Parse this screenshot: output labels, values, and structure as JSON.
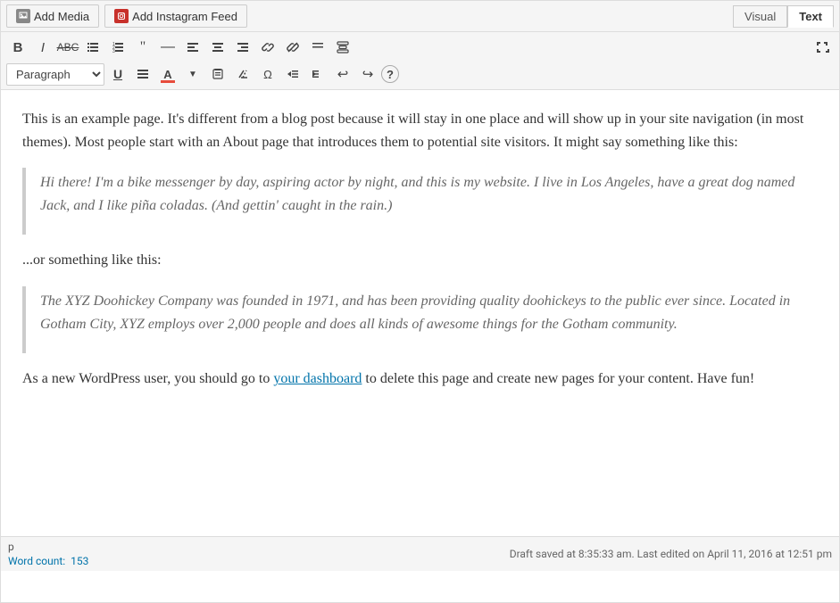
{
  "topbar": {
    "add_media_label": "Add Media",
    "add_instagram_label": "Add Instagram Feed",
    "visual_tab": "Visual",
    "text_tab": "Text"
  },
  "toolbar": {
    "row1": {
      "bold": "B",
      "italic": "I",
      "strikethrough": "ABC",
      "ul": "≡",
      "ol": "≡",
      "blockquote": "\"\"",
      "hr": "—",
      "align_left": "≡",
      "align_center": "≡",
      "align_right": "≡",
      "link": "🔗",
      "unlink": "🔗",
      "insert": "≡",
      "toolbar": "⊞",
      "fullscreen": "⤢"
    },
    "row2": {
      "format_label": "Paragraph",
      "underline": "U",
      "justify": "≡",
      "text_color": "A",
      "paste_text": "📋",
      "clear_format": "◌",
      "special_char": "Ω",
      "indent_dec": "⇤",
      "indent_inc": "⇥",
      "undo": "↩",
      "redo": "↪",
      "help": "?"
    }
  },
  "content": {
    "paragraph1": "This is an example page. It's different from a blog post because it will stay in one place and will show up in your site navigation (in most themes). Most people start with an About page that introduces them to potential site visitors. It might say something like this:",
    "quote1": "Hi there! I'm a bike messenger by day, aspiring actor by night, and this is my website. I live in Los Angeles, have a great dog named Jack, and I like piña coladas. (And gettin' caught in the rain.)",
    "paragraph2": "...or something like this:",
    "quote2": "The XYZ Doohickey Company was founded in 1971, and has been providing quality doohickeys to the public ever since. Located in Gotham City, XYZ employs over 2,000 people and does all kinds of awesome things for the Gotham community.",
    "paragraph3_before_link": "As a new WordPress user, you should go to ",
    "paragraph3_link_text": "your dashboard",
    "paragraph3_link_href": "#",
    "paragraph3_after_link": " to delete this page and create new pages for your content. Have fun!"
  },
  "statusbar": {
    "path": "p",
    "word_count_label": "Word count:",
    "word_count": "153",
    "draft_status": "Draft saved at 8:35:33 am. Last edited on April 11, 2016 at 12:51 pm"
  }
}
